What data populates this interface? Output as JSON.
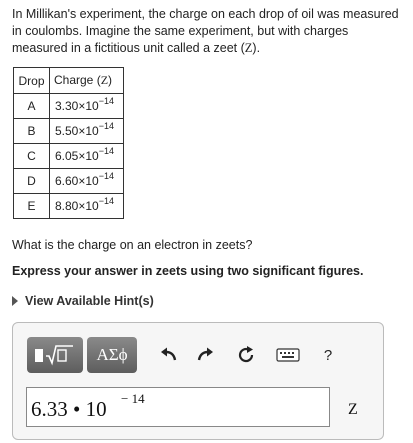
{
  "problem": {
    "intro_part1": "In Millikan's experiment, the charge on each drop of oil was measured in coulombs. Imagine the same experiment, but with charges measured in a fictitious unit called a zeet (",
    "intro_unit": "Z",
    "intro_part2": ").",
    "table": {
      "headers": {
        "drop": "Drop",
        "charge": "Charge (",
        "charge_unit": "Z",
        "charge_close": ")"
      },
      "rows": [
        {
          "drop": "A",
          "mantissa": "3.30×10",
          "exp": "−14"
        },
        {
          "drop": "B",
          "mantissa": "5.50×10",
          "exp": "−14"
        },
        {
          "drop": "C",
          "mantissa": "6.05×10",
          "exp": "−14"
        },
        {
          "drop": "D",
          "mantissa": "6.60×10",
          "exp": "−14"
        },
        {
          "drop": "E",
          "mantissa": "8.80×10",
          "exp": "−14"
        }
      ]
    },
    "question": "What is the charge on an electron in zeets?",
    "instruction": "Express your answer in zeets using two significant figures.",
    "hints_link": "View Available Hint(s)"
  },
  "answer": {
    "toolbar": {
      "templates_icon": "templates-icon",
      "greek_label": "ΑΣϕ",
      "undo_icon": "undo-icon",
      "redo_icon": "redo-icon",
      "reset_icon": "reset-icon",
      "keyboard_icon": "keyboard-icon",
      "help_label": "?"
    },
    "value_mantissa": "6.33 • 10",
    "value_exp": "− 14",
    "unit": "Z"
  }
}
